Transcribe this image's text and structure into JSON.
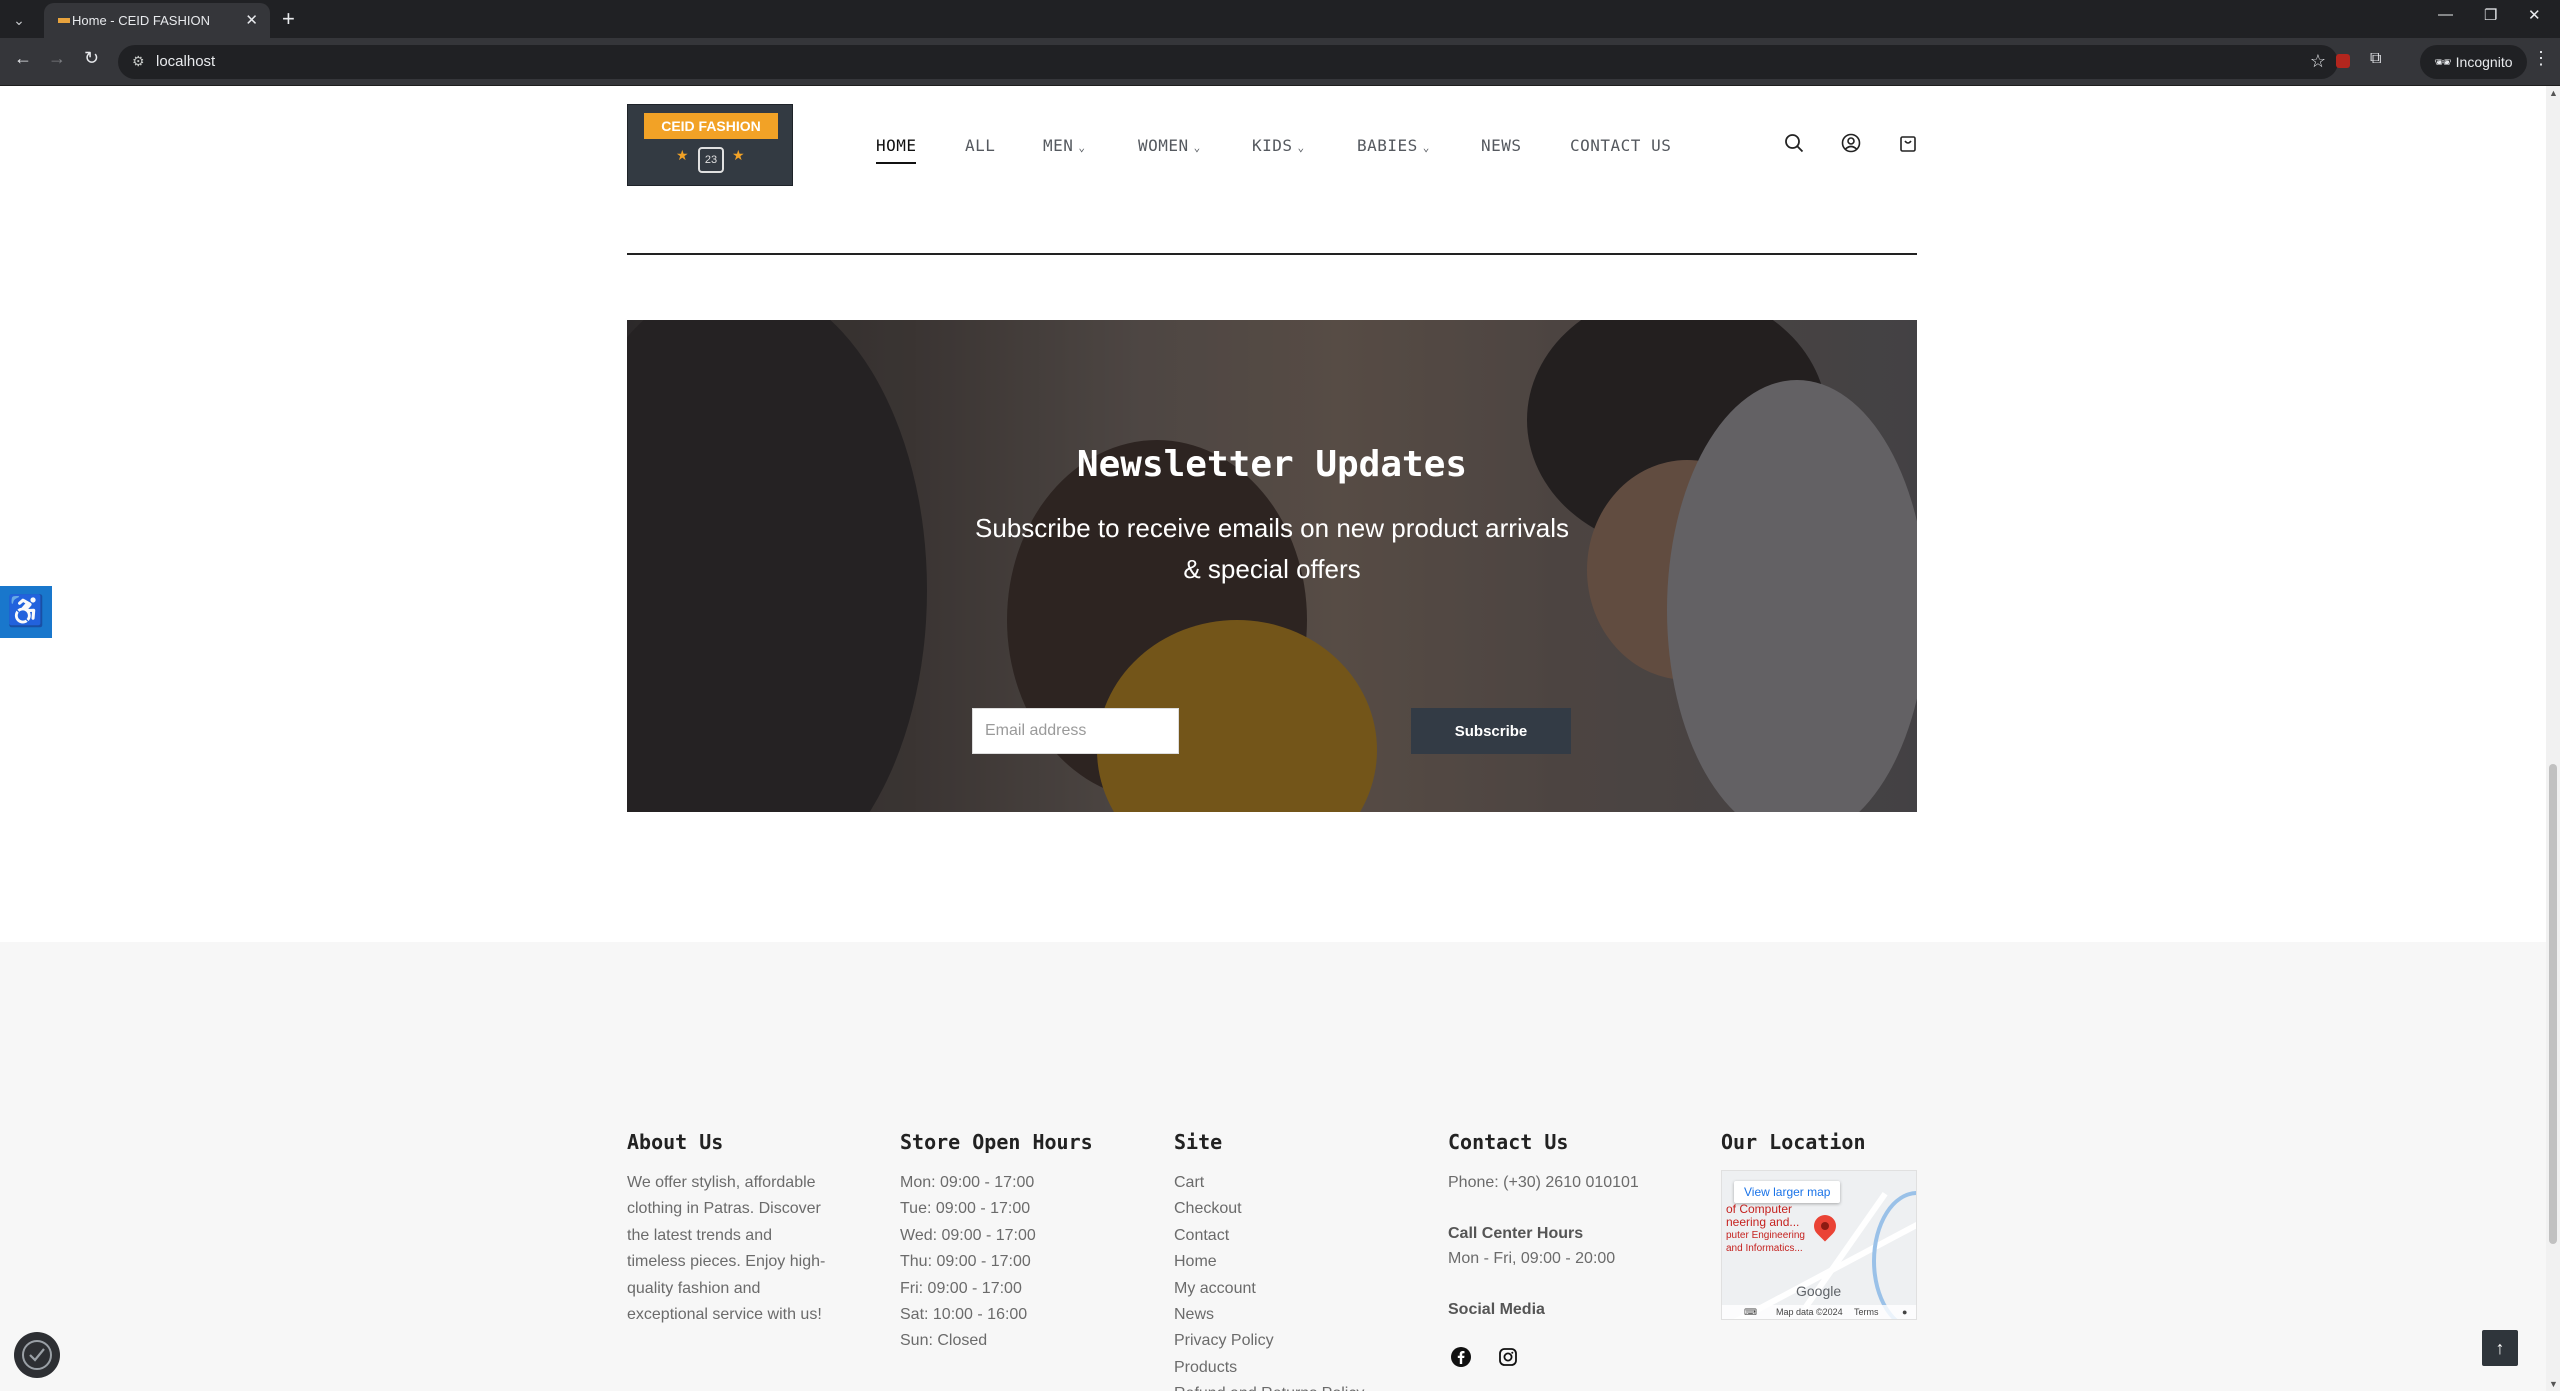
{
  "browser": {
    "tab_title": "Home - CEID FASHION",
    "url": "localhost",
    "incognito_label": "Incognito"
  },
  "site": {
    "logo_text": "CEID FASHION",
    "logo_number": "23",
    "nav": [
      {
        "label": "HOME",
        "active": true,
        "dropdown": false
      },
      {
        "label": "ALL",
        "dropdown": false
      },
      {
        "label": "MEN",
        "dropdown": true
      },
      {
        "label": "WOMEN",
        "dropdown": true
      },
      {
        "label": "KIDS",
        "dropdown": true
      },
      {
        "label": "BABIES",
        "dropdown": true
      },
      {
        "label": "NEWS",
        "dropdown": false
      },
      {
        "label": "CONTACT US",
        "dropdown": false
      }
    ]
  },
  "newsletter": {
    "title": "Newsletter Updates",
    "subtitle": "Subscribe to receive emails on new product arrivals & special offers",
    "email_placeholder": "Email address",
    "button": "Subscribe"
  },
  "footer": {
    "about": {
      "title": "About Us",
      "text": "We offer stylish, affordable clothing in Patras. Discover the latest trends and timeless pieces. Enjoy high-quality fashion and exceptional service with us!"
    },
    "hours": {
      "title": "Store Open Hours",
      "items": [
        "Mon: 09:00 - 17:00",
        "Tue: 09:00 - 17:00",
        "Wed: 09:00 - 17:00",
        "Thu: 09:00 - 17:00",
        "Fri: 09:00 - 17:00",
        "Sat: 10:00 - 16:00",
        "Sun: Closed"
      ]
    },
    "site": {
      "title": "Site",
      "links": [
        "Cart",
        "Checkout",
        "Contact",
        "Home",
        "My account",
        "News",
        "Privacy Policy",
        "Products",
        "Refund and Returns Policy"
      ]
    },
    "contact": {
      "title": "Contact Us",
      "phone": "Phone: (+30) 2610 010101",
      "call_center_title": "Call Center Hours",
      "call_center_hours": "Mon - Fri, 09:00 - 20:00",
      "social_title": "Social Media"
    },
    "location": {
      "title": "Our Location",
      "map_button": "View larger map",
      "map_label_1": "of Computer",
      "map_label_2": "neering and...",
      "map_label_3": "puter Engineering",
      "map_label_4": "and Informatics...",
      "map_brand": "Google",
      "map_data": "Map data ©2024",
      "map_terms": "Terms"
    }
  },
  "colors": {
    "accent": "#f2a226",
    "dark": "#333b45",
    "a11y_blue": "#1977cc"
  }
}
